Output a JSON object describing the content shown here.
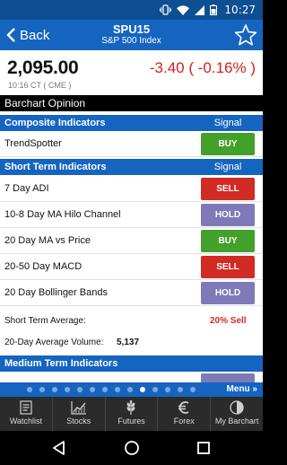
{
  "status_bar": {
    "time": "10:27"
  },
  "header": {
    "back_label": "Back",
    "symbol": "SPU15",
    "symbol_name": "S&P 500 Index"
  },
  "quote": {
    "price": "2,095.00",
    "change": "-3.40 ( -0.16% )",
    "timestamp": "10:16 CT ( CME )"
  },
  "opinion_title": "Barchart Opinion",
  "composite": {
    "title": "Composite Indicators",
    "signal_header": "Signal",
    "rows": [
      {
        "label": "TrendSpotter",
        "signal": "BUY"
      }
    ]
  },
  "short_term": {
    "title": "Short Term Indicators",
    "signal_header": "Signal",
    "rows": [
      {
        "label": "7 Day ADI",
        "signal": "SELL"
      },
      {
        "label": "10-8 Day MA Hilo Channel",
        "signal": "HOLD"
      },
      {
        "label": "20 Day MA vs Price",
        "signal": "BUY"
      },
      {
        "label": "20-50 Day MACD",
        "signal": "SELL"
      },
      {
        "label": "20 Day Bollinger Bands",
        "signal": "HOLD"
      }
    ],
    "average_label": "Short Term Average:",
    "average_value": "20% Sell",
    "volume_label": "20-Day Average Volume:",
    "volume_value": "5,137"
  },
  "medium_term": {
    "title": "Medium Term Indicators"
  },
  "pager": {
    "page_count": 14,
    "active_index": 9,
    "menu_label": "Menu »"
  },
  "bottom_nav": [
    {
      "label": "Watchlist",
      "icon": "watchlist-icon"
    },
    {
      "label": "Stocks",
      "icon": "stocks-chart-icon"
    },
    {
      "label": "Futures",
      "icon": "wheat-icon"
    },
    {
      "label": "Forex",
      "icon": "euro-icon"
    },
    {
      "label": "My Barchart",
      "icon": "barchart-logo-icon"
    }
  ],
  "colors": {
    "header": "#1565c0",
    "status_bar": "#0d4f92",
    "buy": "#43a02b",
    "sell": "#d12b23",
    "hold": "#7e7ab8",
    "negative": "#d32020"
  }
}
